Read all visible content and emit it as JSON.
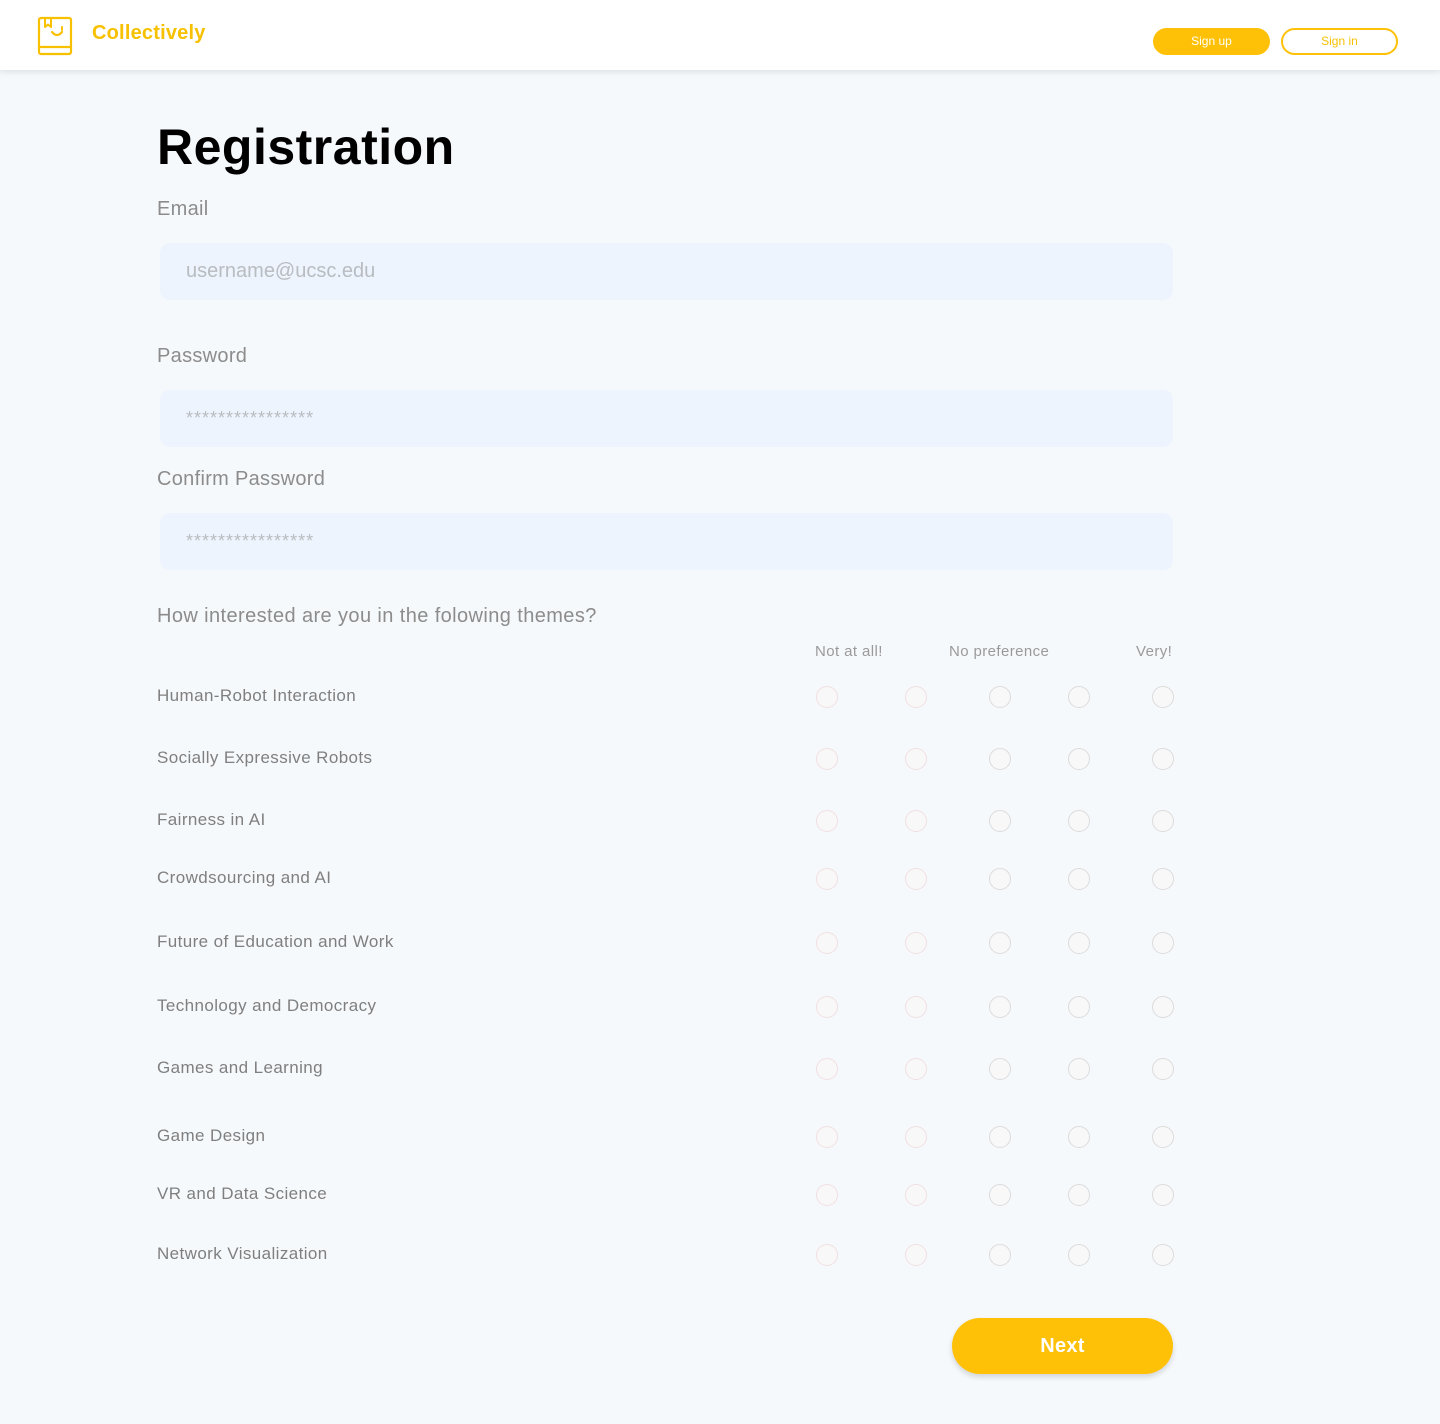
{
  "app": {
    "brand": "Collectively",
    "logo_icon": "book-smile-icon"
  },
  "header": {
    "signup_label": "Sign up",
    "signin_label": "Sign in"
  },
  "page": {
    "title": "Registration"
  },
  "form": {
    "email": {
      "label": "Email",
      "placeholder": "username@ucsc.edu",
      "value": ""
    },
    "password": {
      "label": "Password",
      "placeholder": "****************",
      "value": ""
    },
    "confirm_password": {
      "label": "Confirm Password",
      "placeholder": "****************",
      "value": ""
    }
  },
  "survey": {
    "question": "How interested are you in the folowing themes?",
    "scale_labels": {
      "low": "Not at all!",
      "mid": "No preference",
      "high": "Very!"
    },
    "scale_points": 5,
    "themes": [
      {
        "label": "Human-Robot Interaction",
        "selected": null
      },
      {
        "label": "Socially Expressive Robots",
        "selected": null
      },
      {
        "label": "Fairness in AI",
        "selected": null
      },
      {
        "label": "Crowdsourcing and AI",
        "selected": null
      },
      {
        "label": "Future of Education and Work",
        "selected": null
      },
      {
        "label": "Technology and Democracy",
        "selected": null
      },
      {
        "label": "Games and Learning",
        "selected": null
      },
      {
        "label": "Game Design",
        "selected": null
      },
      {
        "label": "VR and Data Science",
        "selected": null
      },
      {
        "label": "Network Visualization",
        "selected": null
      }
    ]
  },
  "actions": {
    "next_label": "Next"
  },
  "colors": {
    "accent": "#ffc107",
    "brand_text": "#f7c100",
    "input_bg": "#edf4fd",
    "page_bg": "#f6f9fc"
  }
}
